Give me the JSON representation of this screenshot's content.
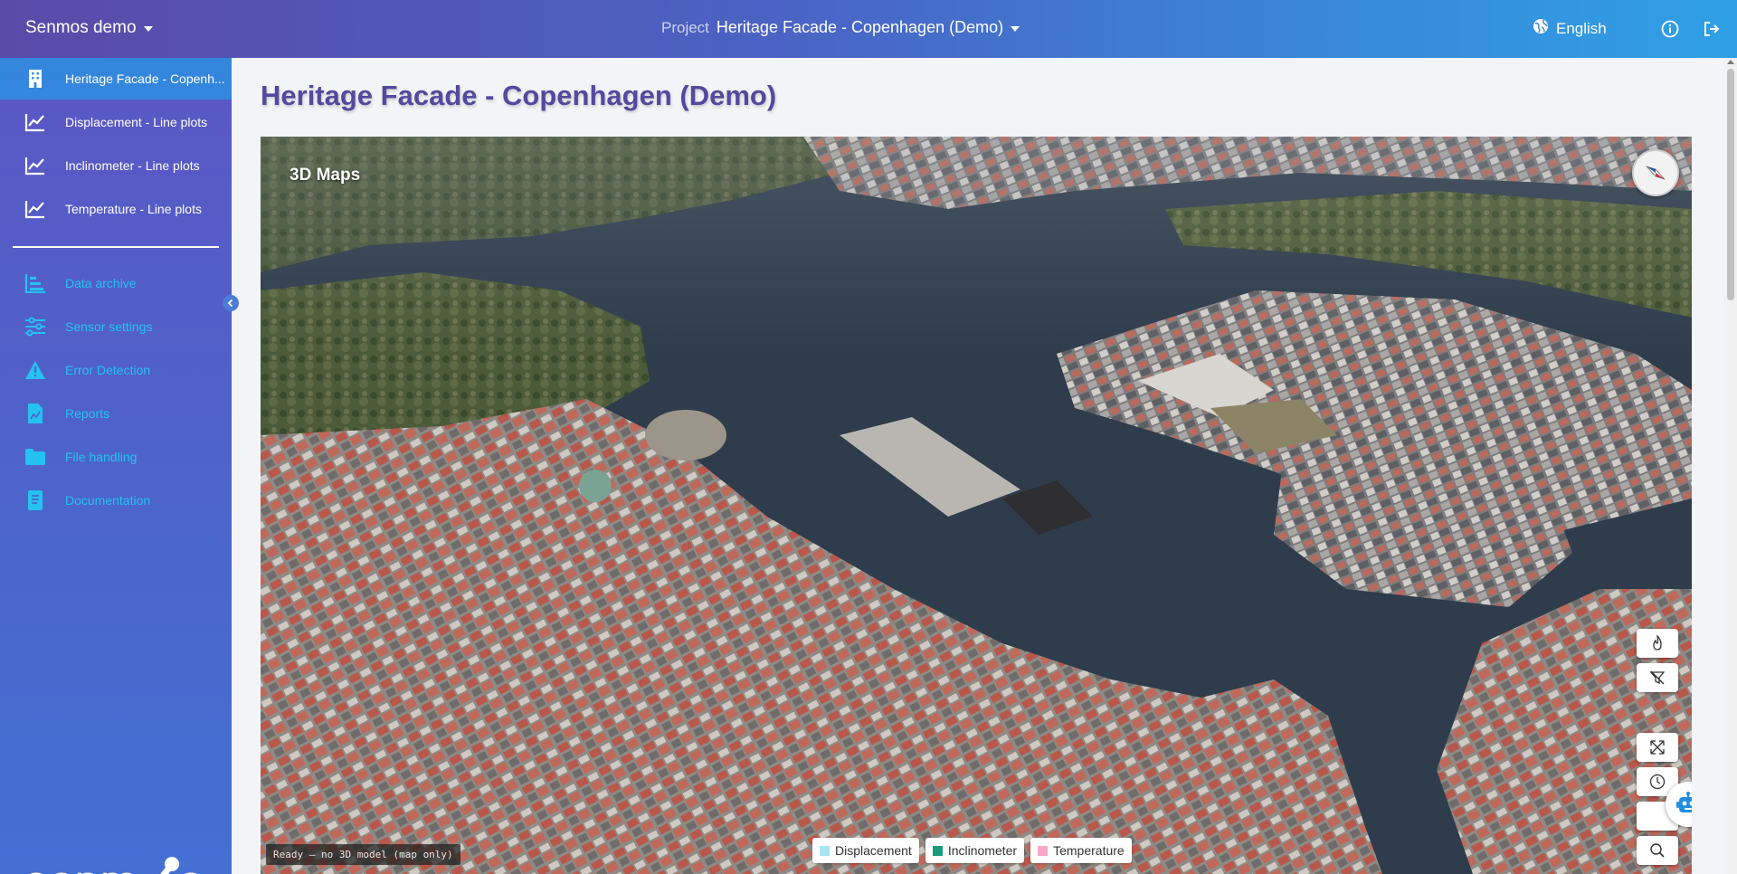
{
  "topbar": {
    "org_name": "Senmos demo",
    "project_label": "Project",
    "project_name": "Heritage Facade - Copenhagen (Demo)",
    "language": "English",
    "icons": [
      "globe-icon",
      "info-icon",
      "logout-icon"
    ]
  },
  "sidebar": {
    "project_items": [
      {
        "label": "Heritage Facade - Copenh...",
        "icon": "building-icon",
        "active": true
      },
      {
        "label": "Displacement - Line plots",
        "icon": "line-chart-icon"
      },
      {
        "label": "Inclinometer - Line plots",
        "icon": "line-chart-icon"
      },
      {
        "label": "Temperature - Line plots",
        "icon": "line-chart-icon"
      }
    ],
    "tools": [
      {
        "label": "Data archive",
        "icon": "bar-chart-icon"
      },
      {
        "label": "Sensor settings",
        "icon": "sliders-icon"
      },
      {
        "label": "Error Detection",
        "icon": "warning-icon"
      },
      {
        "label": "Reports",
        "icon": "report-icon"
      },
      {
        "label": "File handling",
        "icon": "folder-icon"
      },
      {
        "label": "Documentation",
        "icon": "document-icon"
      }
    ],
    "logo_text": "senmos",
    "accent_color": "#25c2f0"
  },
  "main": {
    "page_title": "Heritage Facade - Copenhagen (Demo)",
    "map": {
      "title": "3D Maps",
      "status": "Ready — no 3D model (map only)",
      "legend": [
        {
          "label": "Displacement",
          "color": "#a8e4f4"
        },
        {
          "label": "Inclinometer",
          "color": "#1a9a7a"
        },
        {
          "label": "Temperature",
          "color": "#f7a8c8"
        }
      ],
      "controls": [
        "fire-icon",
        "filter-off-icon",
        "fullscreen-icon",
        "clock-icon",
        "search-icon"
      ],
      "assistant_icon": "robot-icon"
    }
  }
}
